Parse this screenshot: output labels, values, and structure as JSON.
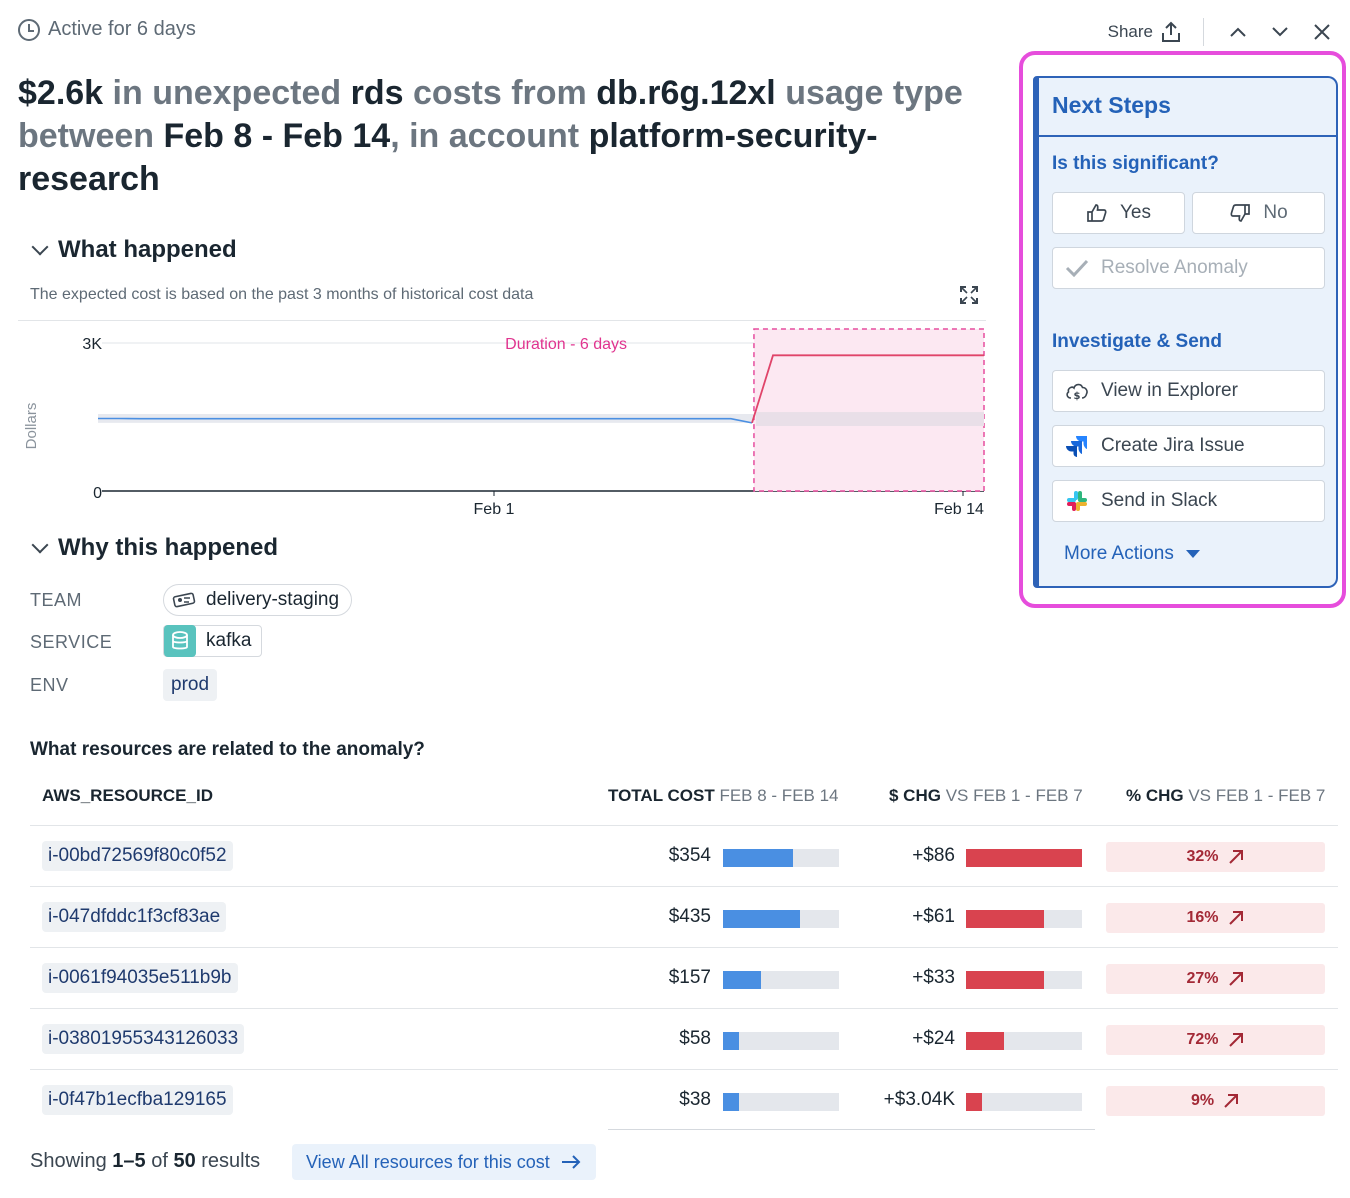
{
  "header": {
    "active_text": "Active for 6 days",
    "share_label": "Share"
  },
  "title": {
    "amount": "$2.6k",
    "t1": " in unexpected ",
    "service": "rds",
    "t2": " costs from ",
    "usage": "db.r6g.12xl",
    "t3": " usage type between ",
    "dates": "Feb 8 - Feb 14",
    "t4": ", in account ",
    "account": "platform-security-research"
  },
  "what": {
    "heading": "What happened",
    "note": "The expected cost is based on the past 3 months of historical cost data"
  },
  "chart_data": {
    "type": "line",
    "ylabel": "Dollars",
    "yticks": [
      "3K",
      "0"
    ],
    "ylim": [
      0,
      3000
    ],
    "xticks": [
      "Feb 1",
      "Feb 14"
    ],
    "annotation": "Duration - 6 days",
    "series": [
      {
        "values": [
          1470,
          1470,
          1465,
          1465,
          1465,
          1465,
          1465,
          1465,
          1465,
          1465,
          1465,
          1465,
          1465,
          1465,
          1465,
          1465,
          1465,
          1465,
          1465,
          1465,
          1465,
          1465,
          1465,
          1465,
          1465,
          1465,
          1465,
          1465,
          1465,
          1465,
          1465,
          1380,
          2750,
          2750,
          2750,
          2750,
          2750,
          2750,
          2750,
          2750,
          2750,
          2750,
          2750
        ]
      }
    ],
    "colors": {
      "expected": "#4a8fe2",
      "actual": "#e0446a",
      "band": "#e7e9ef",
      "duration": "#e64d9e"
    }
  },
  "why": {
    "heading": "Why this happened",
    "team_label": "TEAM",
    "team_value": "delivery-staging",
    "service_label": "SERVICE",
    "service_value": "kafka",
    "env_label": "ENV",
    "env_value": "prod"
  },
  "resources": {
    "question": "What resources are related to the anomaly?",
    "col1": "AWS_RESOURCE_ID",
    "col2_a": "TOTAL COST",
    "col2_b": " FEB 8 - FEB 14",
    "col3_a": "$ CHG",
    "col3_b": " VS FEB 1 - FEB 7",
    "col4_a": "% CHG",
    "col4_b": " VS FEB 1 - FEB 7",
    "rows": [
      {
        "id": "i-00bd72569f80c0f52",
        "cost": "$354",
        "cost_frac": 0.6,
        "chg": "+$86",
        "chg_frac": 1.0,
        "pct": "32%"
      },
      {
        "id": "i-047dfddc1f3cf83ae",
        "cost": "$435",
        "cost_frac": 0.66,
        "chg": "+$61",
        "chg_frac": 0.67,
        "pct": "16%"
      },
      {
        "id": "i-0061f94035e511b9b",
        "cost": "$157",
        "cost_frac": 0.33,
        "chg": "+$33",
        "chg_frac": 0.67,
        "pct": "27%"
      },
      {
        "id": "i-03801955343126033",
        "cost": "$58",
        "cost_frac": 0.14,
        "chg": "+$24",
        "chg_frac": 0.33,
        "pct": "72%"
      },
      {
        "id": "i-0f47b1ecfba129165",
        "cost": "$38",
        "cost_frac": 0.14,
        "chg": "+$3.04K",
        "chg_frac": 0.14,
        "pct": "9%"
      }
    ],
    "showing_prefix": "Showing ",
    "showing_range": "1–5",
    "showing_of": " of ",
    "showing_total": "50",
    "showing_suffix": " results",
    "view_all": "View All resources for this cost"
  },
  "next_steps": {
    "title": "Next Steps",
    "significant_q": "Is this significant?",
    "yes": "Yes",
    "no": "No",
    "resolve": "Resolve Anomaly",
    "investigate": "Investigate & Send",
    "explorer": "View in Explorer",
    "jira": "Create Jira Issue",
    "slack": "Send in Slack",
    "more": "More Actions"
  }
}
